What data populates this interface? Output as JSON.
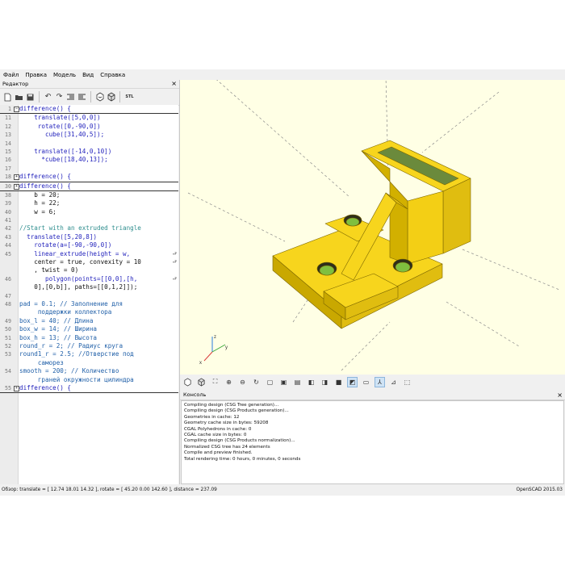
{
  "menu": [
    "Файл",
    "Правка",
    "Модель",
    "Вид",
    "Справка"
  ],
  "editor": {
    "title": "Редактор",
    "close": "×",
    "toolbar": {
      "icons": [
        "new-file-icon",
        "open-file-icon",
        "save-file-icon",
        "undo-icon",
        "redo-icon",
        "unindent-icon",
        "indent-icon",
        "preview-icon",
        "render-icon"
      ],
      "export_label": "STL"
    },
    "lines": [
      {
        "n": "1",
        "fold": "−",
        "t": "difference() {",
        "sep": true
      },
      {
        "n": "11",
        "t": "    translate([5,0,0])"
      },
      {
        "n": "12",
        "t": "     rotate([0,-90,0])"
      },
      {
        "n": "13",
        "t": "       cube([31,40,5]);"
      },
      {
        "n": "14",
        "t": ""
      },
      {
        "n": "15",
        "t": "    translate([-14,0,10])"
      },
      {
        "n": "16",
        "t": "      *cube([18,40,13]);"
      },
      {
        "n": "17",
        "t": ""
      },
      {
        "n": "18",
        "fold": "+",
        "t": "difference() {",
        "sep": true
      },
      {
        "n": "30",
        "fold": "+",
        "t": "difference() {",
        "sep": true
      },
      {
        "n": "38",
        "t": "    b = 20;"
      },
      {
        "n": "39",
        "t": "    h = 22;"
      },
      {
        "n": "40",
        "t": "    w = 6;"
      },
      {
        "n": "41",
        "t": ""
      },
      {
        "n": "42",
        "t": "//Start with an extruded triangle"
      },
      {
        "n": "43",
        "t": "  translate([5,20,8])"
      },
      {
        "n": "44",
        "t": "    rotate(a=[-90,-90,0])"
      },
      {
        "n": "45",
        "t": "    linear_extrude(height = w,",
        "wrap": true
      },
      {
        "n": "",
        "t": "    center = true, convexity = 10",
        "wrap": true
      },
      {
        "n": "",
        "t": "    , twist = 0)"
      },
      {
        "n": "46",
        "t": "       polygon(points=[[0,0],[h,",
        "wrap": true
      },
      {
        "n": "",
        "t": "    0],[0,b]], paths=[[0,1,2]]);"
      },
      {
        "n": "47",
        "t": ""
      },
      {
        "n": "48",
        "t": "pad = 0.1; // Заполнение для"
      },
      {
        "n": "",
        "t": "     поддержки коллектора"
      },
      {
        "n": "49",
        "t": "box_l = 40; // Длина"
      },
      {
        "n": "50",
        "t": "box_w = 14; // Ширина"
      },
      {
        "n": "51",
        "t": "box_h = 13; // Высота"
      },
      {
        "n": "52",
        "t": "round_r = 2; // Радиус круга"
      },
      {
        "n": "53",
        "t": "round1_r = 2.5; //Отверстие под"
      },
      {
        "n": "",
        "t": "     саморез"
      },
      {
        "n": "54",
        "t": "smooth = 200; // Количество"
      },
      {
        "n": "",
        "t": "     граней окружности цилиндра"
      },
      {
        "n": "55",
        "fold": "+",
        "t": "difference() {",
        "sep": true
      }
    ]
  },
  "viewport": {
    "background": "#ffffe5",
    "model_color": "#f7d51d",
    "axes_labels": [
      "z",
      "y",
      "x"
    ]
  },
  "view_toolbar": {
    "icons": [
      "preview-icon",
      "render-icon",
      "zoom-all-icon",
      "zoom-in-icon",
      "zoom-out-icon",
      "reset-view-icon",
      "view-right-icon",
      "view-top-icon",
      "view-bottom-icon",
      "view-left-icon",
      "view-front-icon",
      "view-back-icon",
      "perspective-icon",
      "orthogonal-icon",
      "show-axes-icon",
      "show-scale-icon",
      "show-edges-icon"
    ]
  },
  "console": {
    "title": "Консоль",
    "close": "×",
    "lines": [
      "Compiling design (CSG Tree generation)...",
      "Compiling design (CSG Products generation)...",
      "Geometries in cache: 12",
      "Geometry cache size in bytes: 59208",
      "CGAL Polyhedrons in cache: 0",
      "CGAL cache size in bytes: 0",
      "Compiling design (CSG Products normalization)...",
      "Normalized CSG tree has 24 elements",
      "Compile and preview finished.",
      "Total rendering time: 0 hours, 0 minutes, 0 seconds"
    ]
  },
  "status": {
    "text": "Обзор: translate = [ 12.74 18.01 14.32 ], rotate = [ 45.20 0.00 142.60 ], distance = 237.09",
    "version": "OpenSCAD 2015.03"
  }
}
